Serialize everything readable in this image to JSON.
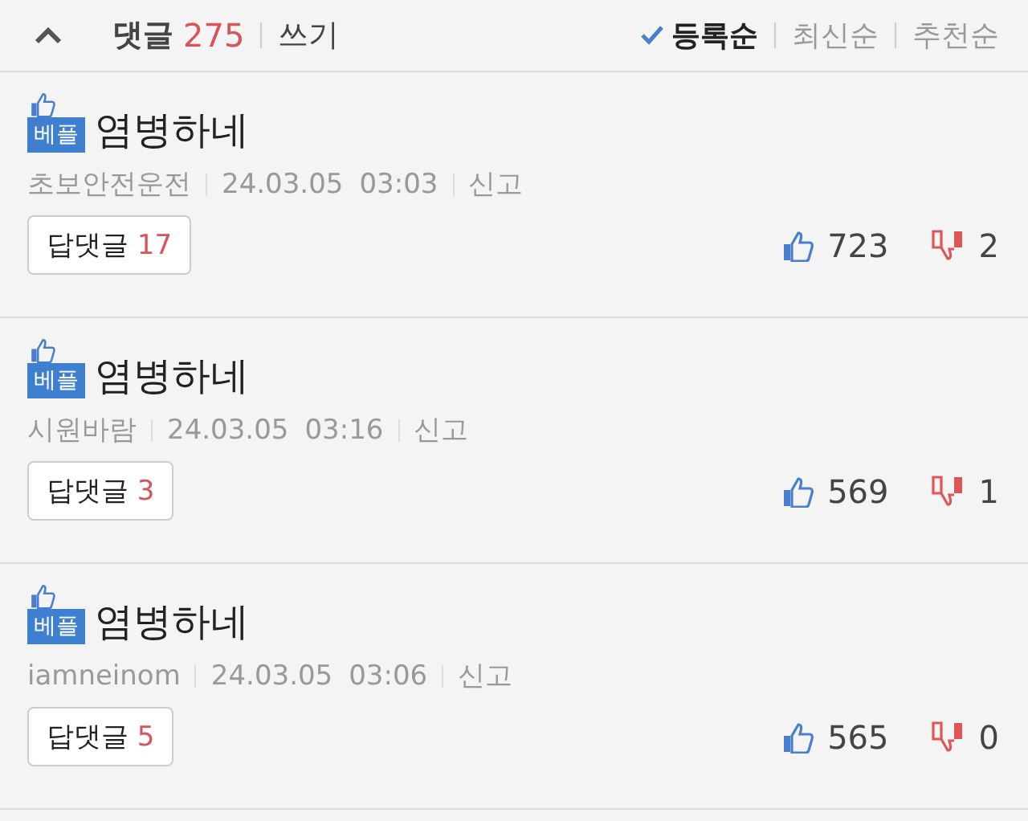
{
  "header": {
    "comment_label": "댓글",
    "comment_count": "275",
    "write_link": "쓰기",
    "sort_options": [
      {
        "label": "등록순",
        "selected": true
      },
      {
        "label": "최신순",
        "selected": false
      },
      {
        "label": "추천순",
        "selected": false
      }
    ]
  },
  "comments": [
    {
      "badge": "베플",
      "text": "염병하네",
      "author": "초보안전운전",
      "date": "24.03.05",
      "time": "03:03",
      "report": "신고",
      "reply_label": "답댓글",
      "reply_count": "17",
      "likes": "723",
      "dislikes": "2"
    },
    {
      "badge": "베플",
      "text": "염병하네",
      "author": "시원바람",
      "date": "24.03.05",
      "time": "03:16",
      "report": "신고",
      "reply_label": "답댓글",
      "reply_count": "3",
      "likes": "569",
      "dislikes": "1"
    },
    {
      "badge": "베플",
      "text": "염병하네",
      "author": "iamneinom",
      "date": "24.03.05",
      "time": "03:06",
      "report": "신고",
      "reply_label": "답댓글",
      "reply_count": "5",
      "likes": "565",
      "dislikes": "0"
    }
  ]
}
